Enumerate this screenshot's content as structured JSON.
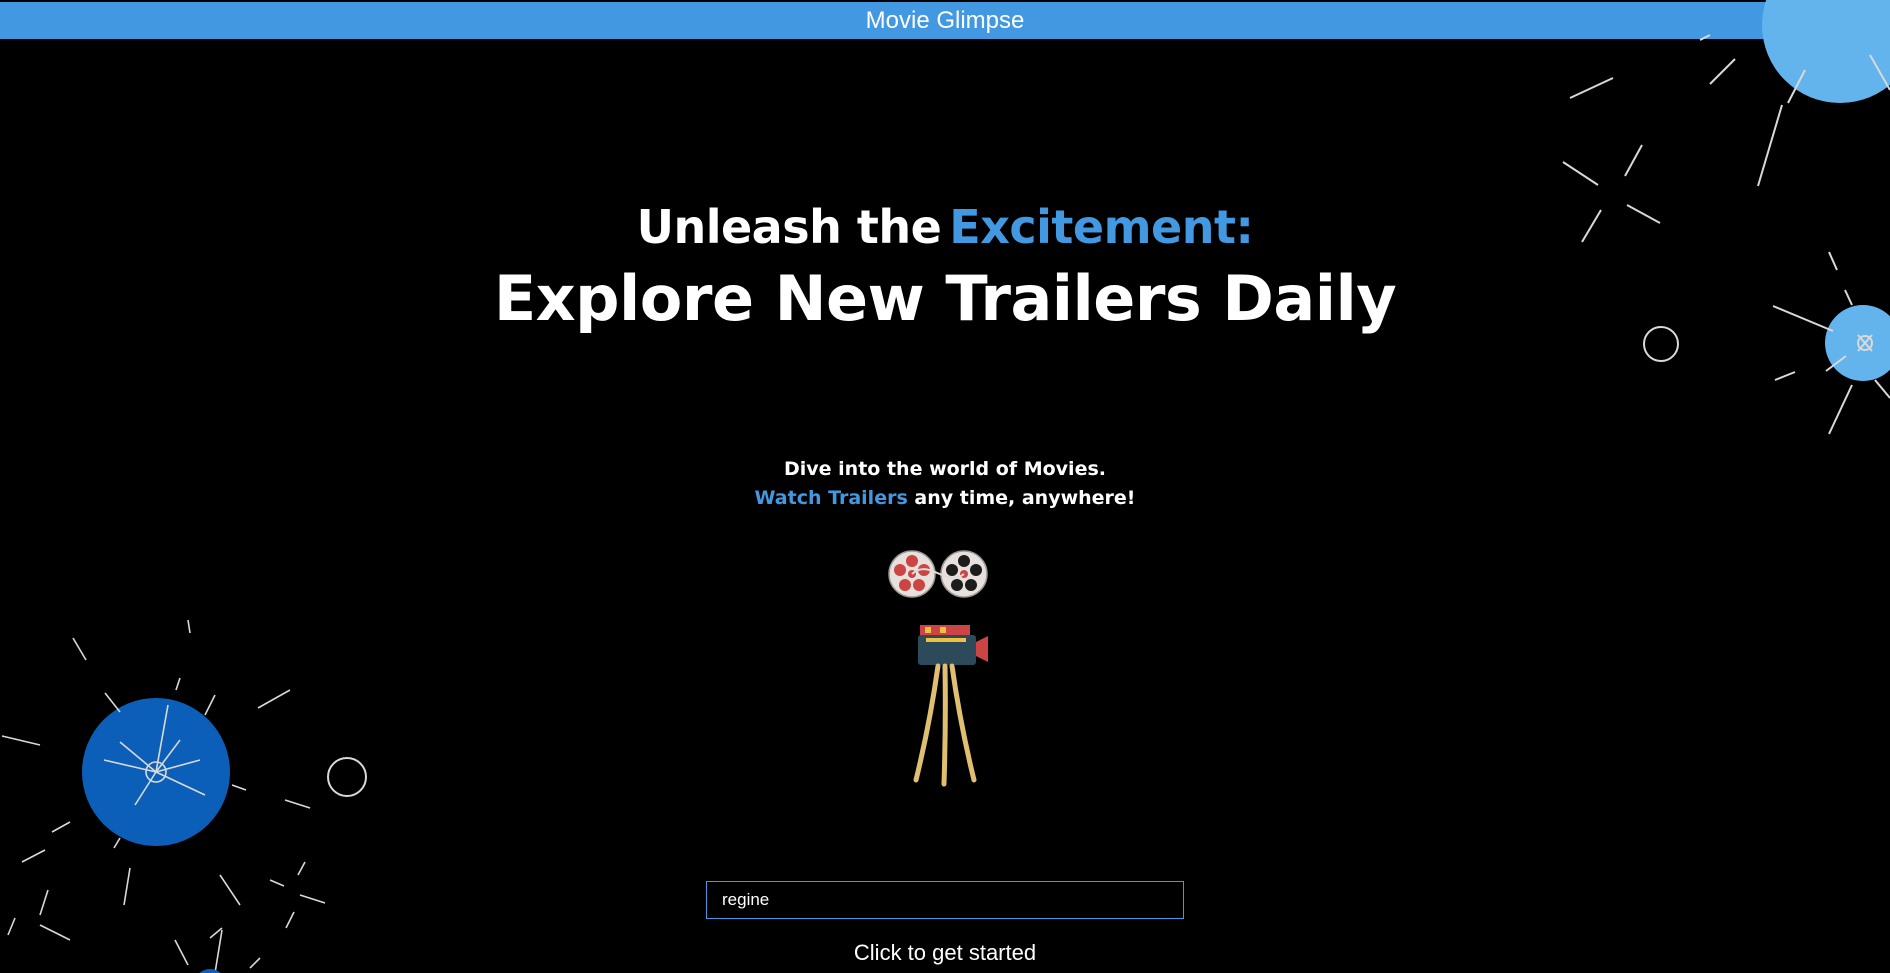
{
  "header": {
    "title": "Movie Glimpse"
  },
  "hero": {
    "prefix": "Unleash the",
    "accent": "Excitement:",
    "headline": "Explore New Trailers Daily"
  },
  "subtitle": {
    "line1": "Dive into the world of Movies.",
    "link": "Watch Trailers",
    "line2_rest": "any time, anywhere!"
  },
  "illustration": {
    "icon": "movie-camera-icon"
  },
  "search": {
    "value": "regine"
  },
  "cta": {
    "label": "Click to get started"
  },
  "colors": {
    "accent": "#4299e1",
    "background": "#000000",
    "deco_blue": "#0b5fb8",
    "deco_light_blue": "#63b3ed"
  }
}
